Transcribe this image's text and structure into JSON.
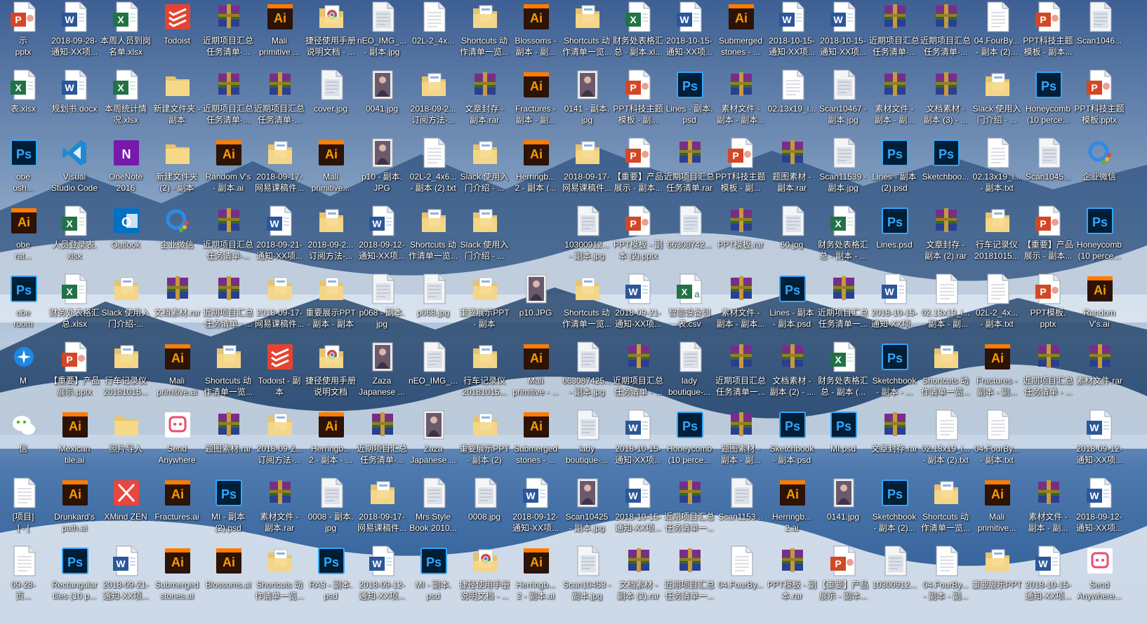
{
  "desktop": {
    "colors": {
      "sky_top": "#3d5f93",
      "sky_mid": "#8ba6c6",
      "cloud": "#e6edf5",
      "mountain": "#1e3f66"
    },
    "rows": [
      [
        {
          "label": "示\npptx",
          "icon": "pptx-icon"
        },
        {
          "label": "2018-09-28-\n通知-XX项...",
          "icon": "word-icon"
        },
        {
          "label": "本周人员到岗\n名单.xlsx",
          "icon": "excel-icon"
        },
        {
          "label": "Todoist",
          "icon": "todoist-icon"
        },
        {
          "label": "近期项目汇总\n任务清单-...",
          "icon": "rar-icon"
        },
        {
          "label": "Mali\nprimitive ...",
          "icon": "ai-icon"
        },
        {
          "label": "捷径使用手册\n说明文档 - ...",
          "icon": "chrome-doc-icon"
        },
        {
          "label": "nEO_IMG_...\n- 副本.jpg",
          "icon": "jpg-icon"
        },
        {
          "label": "02L-2_4x...",
          "icon": "txt-icon"
        },
        {
          "label": "Shortcuts 动\n作清单一览...",
          "icon": "folder-doc-icon"
        },
        {
          "label": "Blossoms -\n副本 - 副...",
          "icon": "ai-icon"
        },
        {
          "label": "Shortcuts 动\n作清单一览...",
          "icon": "folder-doc-icon"
        },
        {
          "label": "财务处表格汇\n总 - 副本.xl...",
          "icon": "excel-icon"
        },
        {
          "label": "2018-10-15-\n通知-XX项...",
          "icon": "word-icon"
        },
        {
          "label": "Submerged\nstones - ...",
          "icon": "ai-icon"
        },
        {
          "label": "2018-10-15-\n通知-XX项...",
          "icon": "word-icon"
        },
        {
          "label": "2018-10-15-\n通知-XX项...",
          "icon": "word-icon"
        },
        {
          "label": "近期项目汇总\n任务清单-...",
          "icon": "rar-icon"
        },
        {
          "label": "近期项目汇总\n任务清单-...",
          "icon": "rar-icon"
        },
        {
          "label": "04.FourBy...\n- 副本 (2)...",
          "icon": "txt-icon"
        },
        {
          "label": "PPT科技主题\n模板 - 副本...",
          "icon": "pptx-icon"
        },
        {
          "label": "Scan1046...",
          "icon": "jpg-icon"
        }
      ],
      [
        {
          "label": "表.xlsx",
          "icon": "excel-icon"
        },
        {
          "label": "规划书.docx",
          "icon": "word-icon"
        },
        {
          "label": "本周统计情\n况.xlsx",
          "icon": "excel-icon"
        },
        {
          "label": "新建文件夹 -\n副本",
          "icon": "folder-icon"
        },
        {
          "label": "近期项目汇总\n任务清单-...",
          "icon": "rar-icon"
        },
        {
          "label": "近期项目汇总\n任务清单-...",
          "icon": "rar-icon"
        },
        {
          "label": "cover.jpg",
          "icon": "jpg-icon"
        },
        {
          "label": "0041.jpg",
          "icon": "photo-icon"
        },
        {
          "label": "2018-09-2...\n订阅方法-...",
          "icon": "folder-doc-icon"
        },
        {
          "label": "文章封存 -\n副本.rar",
          "icon": "rar-icon"
        },
        {
          "label": "Fractures -\n副本 - 副...",
          "icon": "ai-icon"
        },
        {
          "label": "0141 - 副本.\njpg",
          "icon": "photo-icon"
        },
        {
          "label": "PPT科技主题\n模板 - 副...",
          "icon": "pptx-icon"
        },
        {
          "label": "Lines - 副本.\npsd",
          "icon": "ps-icon"
        },
        {
          "label": "素材文件 -\n副本 - 副本...",
          "icon": "rar-icon"
        },
        {
          "label": "02.13x19_i...",
          "icon": "txt-icon"
        },
        {
          "label": "Scan10467 -\n副本.jpg",
          "icon": "jpg-icon"
        },
        {
          "label": "素材文件 -\n副本 - 副...",
          "icon": "rar-icon"
        },
        {
          "label": "文档素材 -\n副本 (3) - ...",
          "icon": "rar-icon"
        },
        {
          "label": "Slack 使用入\n门介绍 - ...",
          "icon": "folder-doc-icon"
        },
        {
          "label": "Honeycomb\n(10 perce...",
          "icon": "ps-icon"
        },
        {
          "label": "PPT科技主题\n模板.pptx",
          "icon": "pptx-icon"
        }
      ],
      [
        {
          "label": "obe\nosh...",
          "icon": "ps-icon"
        },
        {
          "label": "Visual\nStudio Code",
          "icon": "vscode-icon"
        },
        {
          "label": "OneNote\n2016",
          "icon": "onenote-icon"
        },
        {
          "label": "新建文件夹\n(2) - 副本",
          "icon": "folder-icon"
        },
        {
          "label": "Random V's\n- 副本.ai",
          "icon": "ai-icon"
        },
        {
          "label": "2018-09-17-\n网易课稿件...",
          "icon": "folder-doc-icon"
        },
        {
          "label": "Mali\nprimitive...",
          "icon": "ai-icon"
        },
        {
          "label": "p10 - 副本.\nJPG",
          "icon": "photo-icon"
        },
        {
          "label": "02L-2_4x6...\n- 副本 (2).txt",
          "icon": "txt-icon"
        },
        {
          "label": "Slack 使用入\n门介绍 - ...",
          "icon": "folder-doc-icon"
        },
        {
          "label": "Herringb...\n2 - 副本 (...",
          "icon": "ai-icon"
        },
        {
          "label": "2018-09-17-\n网易课稿件...",
          "icon": "folder-doc-icon"
        },
        {
          "label": "【重要】产品\n展示 - 副本...",
          "icon": "pptx-icon"
        },
        {
          "label": "近期项目汇总\n任务清单.rar",
          "icon": "rar-icon"
        },
        {
          "label": "PPT科技主题\n模板 - 副...",
          "icon": "pptx-icon"
        },
        {
          "label": "题图素材 -\n副本.rar",
          "icon": "rar-icon"
        },
        {
          "label": "Scan11539 -\n副本.jpg",
          "icon": "jpg-icon"
        },
        {
          "label": "Lines - 副本\n(2).psd",
          "icon": "ps-icon"
        },
        {
          "label": "Sketchboo...",
          "icon": "ps-icon"
        },
        {
          "label": "02.13x19_i...\n- 副本.txt",
          "icon": "txt-icon"
        },
        {
          "label": "Scan1045...",
          "icon": "jpg-icon"
        },
        {
          "label": "企业微信",
          "icon": "wecom-icon"
        }
      ],
      [
        {
          "label": "obe\nrat...",
          "icon": "ai-icon"
        },
        {
          "label": "人员登录表.\nxlsx",
          "icon": "excel-icon"
        },
        {
          "label": "Outlook",
          "icon": "outlook-icon"
        },
        {
          "label": "企业微信",
          "icon": "wecom-icon"
        },
        {
          "label": "近期项目汇总\n任务清单-...",
          "icon": "rar-icon"
        },
        {
          "label": "2018-09-21-\n通知-XX项...",
          "icon": "word-icon"
        },
        {
          "label": "2018-09-2...\n订阅方法-...",
          "icon": "folder-doc-icon"
        },
        {
          "label": "2018-09-12-\n通知-XX项...",
          "icon": "word-icon"
        },
        {
          "label": "Shortcuts 动\n作清单一览...",
          "icon": "folder-doc-icon"
        },
        {
          "label": "Slack 使用入\n门介绍 - ...",
          "icon": "folder-doc-icon"
        },
        {
          "label": "",
          "icon": "none"
        },
        {
          "label": "10300912...\n- 副本.jpg",
          "icon": "jpg-icon"
        },
        {
          "label": "PPT模板 - 副\n本 (2).pptx",
          "icon": "pptx-icon"
        },
        {
          "label": "66308742...",
          "icon": "jpg-icon"
        },
        {
          "label": "PPT模板.rar",
          "icon": "rar-icon"
        },
        {
          "label": "60.jpg",
          "icon": "jpg-icon"
        },
        {
          "label": "财务处表格汇\n总 - 副本 - ...",
          "icon": "excel-icon"
        },
        {
          "label": "Lines.psd",
          "icon": "ps-icon"
        },
        {
          "label": "文章封存 -\n副本 (2).rar",
          "icon": "rar-icon"
        },
        {
          "label": "行车记录仪\n20181015...",
          "icon": "folder-doc-icon"
        },
        {
          "label": "【重要】产品\n展示 - 副本...",
          "icon": "pptx-icon"
        },
        {
          "label": "Honeycomb\n(10 perce...",
          "icon": "ps-icon"
        }
      ],
      [
        {
          "label": "obe\nroom",
          "icon": "ps-icon"
        },
        {
          "label": "财务处表格汇\n总.xlsx",
          "icon": "excel-icon"
        },
        {
          "label": "Slack 使用入\n门介绍-...",
          "icon": "folder-doc-icon"
        },
        {
          "label": "文档素材.rar",
          "icon": "rar-icon"
        },
        {
          "label": "近期项目汇总\n任务清单 - ...",
          "icon": "rar-icon"
        },
        {
          "label": "2018-09-17-\n网易课稿件...",
          "icon": "folder-doc-icon"
        },
        {
          "label": "重要展示PPT\n- 副本 - 副本",
          "icon": "folder-doc-icon"
        },
        {
          "label": "p068 - 副本.\njpg",
          "icon": "jpg-icon"
        },
        {
          "label": "p068.jpg",
          "icon": "jpg-icon"
        },
        {
          "label": "重要展示PPT\n- 副本",
          "icon": "folder-doc-icon"
        },
        {
          "label": "p10.JPG",
          "icon": "photo-icon"
        },
        {
          "label": "Shortcuts 动\n作清单一览...",
          "icon": "folder-doc-icon"
        },
        {
          "label": "2018-09-21-\n通知-XX项...",
          "icon": "word-icon"
        },
        {
          "label": "智能设备列\n表.csv",
          "icon": "csv-icon"
        },
        {
          "label": "素材文件 -\n副本 - 副本...",
          "icon": "rar-icon"
        },
        {
          "label": "Lines - 副本\n- 副本.psd",
          "icon": "ps-icon"
        },
        {
          "label": "近期项目汇总\n任务清单一...",
          "icon": "rar-icon"
        },
        {
          "label": "2018-10-15-\n通知-XX项...",
          "icon": "word-icon"
        },
        {
          "label": "02.13x19_i...\n- 副本 - 副...",
          "icon": "txt-icon"
        },
        {
          "label": "02L-2_4x...\n- 副本.txt",
          "icon": "txt-icon"
        },
        {
          "label": "PPT模板.\npptx",
          "icon": "pptx-icon"
        },
        {
          "label": "Random\nV's.ai",
          "icon": "ai-icon"
        }
      ],
      [
        {
          "label": "M",
          "icon": "app-blue-icon"
        },
        {
          "label": "【重要】产品\n展示.pptx",
          "icon": "pptx-icon"
        },
        {
          "label": "行车记录仪\n20181015...",
          "icon": "folder-doc-icon"
        },
        {
          "label": "Mali\nprimitive.ai",
          "icon": "ai-icon"
        },
        {
          "label": "Shortcuts 动\n作清单一览...",
          "icon": "folder-doc-icon"
        },
        {
          "label": "Todoist - 副\n本",
          "icon": "todoist-icon"
        },
        {
          "label": "捷径使用手册\n说明文档",
          "icon": "chrome-doc-icon"
        },
        {
          "label": "Zaza\nJapanese ...",
          "icon": "photo-icon"
        },
        {
          "label": "nEO_IMG_...",
          "icon": "jpg-icon"
        },
        {
          "label": "行车记录仪\n20181015...",
          "icon": "folder-doc-icon"
        },
        {
          "label": "Mali\nprimitive - ...",
          "icon": "ai-icon"
        },
        {
          "label": "663087425...\n- 副本.jpg",
          "icon": "jpg-icon"
        },
        {
          "label": "近期项目汇总\n任务清单 - ...",
          "icon": "rar-icon"
        },
        {
          "label": "lady\nboutique-...",
          "icon": "jpg-icon"
        },
        {
          "label": "近期项目汇总\n任务清单一...",
          "icon": "rar-icon"
        },
        {
          "label": "文档素材 -\n副本 (2) - ...",
          "icon": "rar-icon"
        },
        {
          "label": "财务处表格汇\n总 - 副本 (...",
          "icon": "excel-icon"
        },
        {
          "label": "Sketchbook\n- 副本 - ...",
          "icon": "ps-icon"
        },
        {
          "label": "Shortcuts 动\n作清单一览...",
          "icon": "folder-doc-icon"
        },
        {
          "label": "Fractures -\n副本 - 副...",
          "icon": "ai-icon"
        },
        {
          "label": "近期项目汇总\n任务清单 - ...",
          "icon": "rar-icon"
        },
        {
          "label": "素材文件.rar",
          "icon": "rar-icon"
        }
      ],
      [
        {
          "label": "信",
          "icon": "wechat-icon"
        },
        {
          "label": "Mexican\ntile.ai",
          "icon": "ai-icon"
        },
        {
          "label": "照片导入",
          "icon": "folder-icon"
        },
        {
          "label": "Send\nAnywhere",
          "icon": "sendanywhere-icon"
        },
        {
          "label": "题图素材.rar",
          "icon": "rar-icon"
        },
        {
          "label": "2018-09-2...\n订阅方法-...",
          "icon": "folder-doc-icon"
        },
        {
          "label": "Herringb...\n2 - 副本 - ...",
          "icon": "ai-icon"
        },
        {
          "label": "近期项目汇总\n任务清单-...",
          "icon": "rar-icon"
        },
        {
          "label": "Zaza\nJapanese ...",
          "icon": "photo-icon"
        },
        {
          "label": "重要展示PPT\n- 副本 (2)",
          "icon": "folder-doc-icon"
        },
        {
          "label": "Submerged\nstones - ...",
          "icon": "ai-icon"
        },
        {
          "label": "lady\nboutique-...",
          "icon": "jpg-icon"
        },
        {
          "label": "2018-10-15-\n通知-XX项...",
          "icon": "word-icon"
        },
        {
          "label": "Honeycomb\n(10 perce...",
          "icon": "ps-icon"
        },
        {
          "label": "题图素材 -\n副本 - 副...",
          "icon": "rar-icon"
        },
        {
          "label": "Sketchbook\n- 副本.psd",
          "icon": "ps-icon"
        },
        {
          "label": "MI.psd",
          "icon": "ps-icon"
        },
        {
          "label": "文章封存.rar",
          "icon": "rar-icon"
        },
        {
          "label": "02.13x19_i...\n- 副本 (2).txt",
          "icon": "txt-icon"
        },
        {
          "label": "04.FourBy...\n- 副本.txt",
          "icon": "txt-icon"
        },
        {
          "label": "",
          "icon": "none"
        },
        {
          "label": "2018-09-12-\n通知-XX项...",
          "icon": "word-icon"
        }
      ],
      [
        {
          "label": "[项目]\n] - [",
          "icon": "txt-icon"
        },
        {
          "label": "Drunkard's\npath.ai",
          "icon": "ai-icon"
        },
        {
          "label": "XMind ZEN",
          "icon": "xmind-icon"
        },
        {
          "label": "Fractures.ai",
          "icon": "ai-icon"
        },
        {
          "label": "MI - 副本\n(2).psd",
          "icon": "ps-icon"
        },
        {
          "label": "素材文件 -\n副本.rar",
          "icon": "rar-icon"
        },
        {
          "label": "0008 - 副本.\njpg",
          "icon": "jpg-icon"
        },
        {
          "label": "2018-09-17-\n网易课稿件...",
          "icon": "folder-doc-icon"
        },
        {
          "label": "Mrs Style\nBook 2010...",
          "icon": "jpg-icon"
        },
        {
          "label": "0008.jpg",
          "icon": "jpg-icon"
        },
        {
          "label": "2018-09-12-\n通知-XX项...",
          "icon": "word-icon"
        },
        {
          "label": "Scan10425\n- 副本.jpg",
          "icon": "photo-icon"
        },
        {
          "label": "2018-10-15-\n通知-XX项...",
          "icon": "word-icon"
        },
        {
          "label": "近期项目汇总\n任务清单一...",
          "icon": "rar-icon"
        },
        {
          "label": "Scan1153...",
          "icon": "jpg-icon"
        },
        {
          "label": "Herringb...\n2.ai",
          "icon": "ai-icon"
        },
        {
          "label": "0141.jpg",
          "icon": "photo-icon"
        },
        {
          "label": "Sketchbook\n- 副本 (2)...",
          "icon": "ps-icon"
        },
        {
          "label": "Shortcuts 动\n作清单一览...",
          "icon": "folder-doc-icon"
        },
        {
          "label": "Mali\nprimitive...",
          "icon": "ai-icon"
        },
        {
          "label": "素材文件 -\n副本 - 副...",
          "icon": "rar-icon"
        },
        {
          "label": "2018-09-12-\n通知-XX项...",
          "icon": "word-icon"
        }
      ],
      [
        {
          "label": "09-28-\n页...",
          "icon": "txt-icon"
        },
        {
          "label": "Rectangular\ntiles (10 p...",
          "icon": "ps-icon"
        },
        {
          "label": "2018-09-21-\n通知-XX项...",
          "icon": "word-icon"
        },
        {
          "label": "Submerged\nstones.ai",
          "icon": "ai-icon"
        },
        {
          "label": "Blossoms.ai",
          "icon": "ai-icon"
        },
        {
          "label": "Shortcuts 动\n作清单一览...",
          "icon": "folder-doc-icon"
        },
        {
          "label": "RA3 - 副本.\npsd",
          "icon": "ps-icon"
        },
        {
          "label": "2018-09-12-\n通知-XX项...",
          "icon": "word-icon"
        },
        {
          "label": "MI - 副本.\npsd",
          "icon": "ps-icon"
        },
        {
          "label": "捷径使用手册\n说明文档 - ...",
          "icon": "chrome-doc-icon"
        },
        {
          "label": "Herringb...\n2 - 副本.ai",
          "icon": "ai-icon"
        },
        {
          "label": "Scan10453 -\n副本.jpg",
          "icon": "jpg-icon"
        },
        {
          "label": "文档素材 -\n副本 (2).rar",
          "icon": "rar-icon"
        },
        {
          "label": "近期项目汇总\n任务清单一...",
          "icon": "rar-icon"
        },
        {
          "label": "04.FourBy...",
          "icon": "txt-icon"
        },
        {
          "label": "PPT模板 - 副\n本.rar",
          "icon": "rar-icon"
        },
        {
          "label": "【重要】产品\n展示 - 副本...",
          "icon": "pptx-icon"
        },
        {
          "label": "10300912...",
          "icon": "jpg-icon"
        },
        {
          "label": "04.FourBy...\n- 副本 - 副...",
          "icon": "txt-icon"
        },
        {
          "label": "重要展示PPT",
          "icon": "folder-doc-icon"
        },
        {
          "label": "2018-10-15-\n通知-XX项...",
          "icon": "word-icon"
        },
        {
          "label": "Send\nAnywhere...",
          "icon": "sendanywhere-icon"
        }
      ]
    ]
  }
}
